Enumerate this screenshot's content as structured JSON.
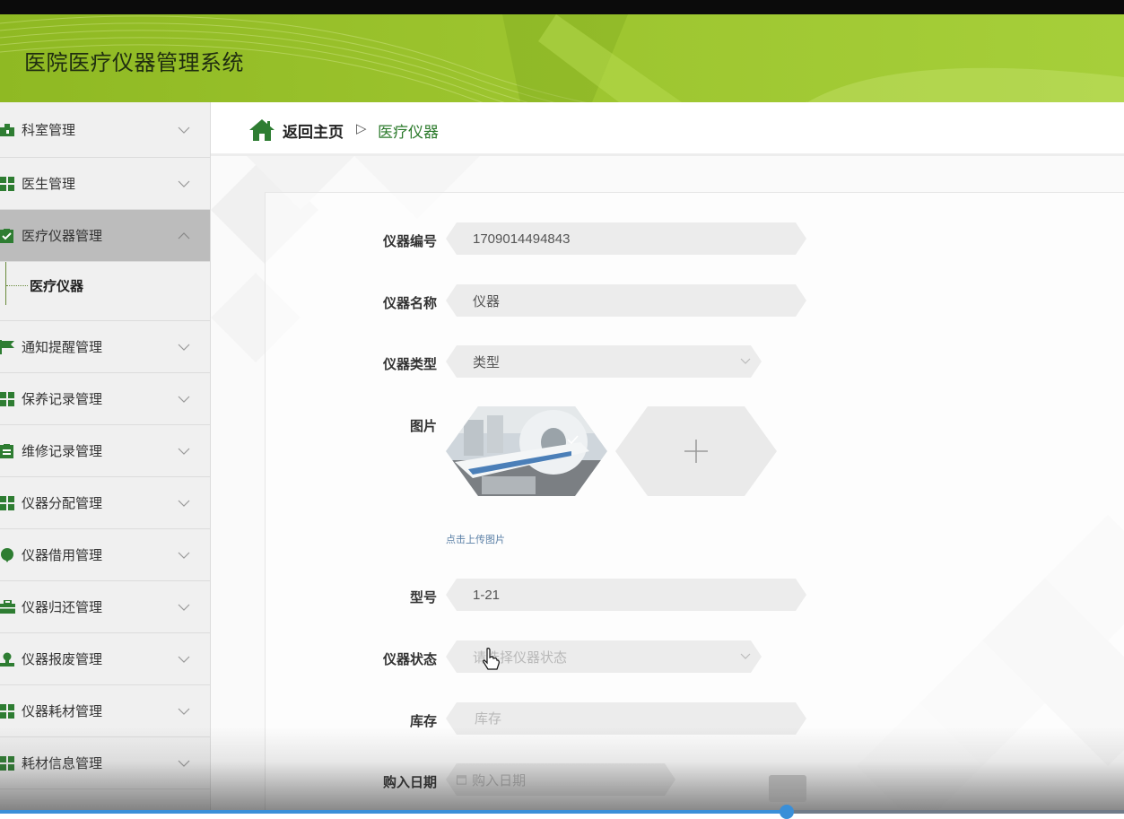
{
  "app": {
    "title": "医院医疗仪器管理系统"
  },
  "colors": {
    "header": "#9cc42e",
    "accent": "#2b7a2b",
    "active_menu": "#bcbcbc",
    "progress": "#3a8fd8"
  },
  "sidebar": {
    "items": [
      {
        "label": "科室管理",
        "icon": "department-icon",
        "expanded": false
      },
      {
        "label": "医生管理",
        "icon": "grid-icon",
        "expanded": false
      },
      {
        "label": "医疗仪器管理",
        "icon": "check-clipboard-icon",
        "expanded": true,
        "active": true
      },
      {
        "label": "通知提醒管理",
        "icon": "flag-icon",
        "expanded": false
      },
      {
        "label": "保养记录管理",
        "icon": "grid-icon",
        "expanded": false
      },
      {
        "label": "维修记录管理",
        "icon": "clipboard-icon",
        "expanded": false
      },
      {
        "label": "仪器分配管理",
        "icon": "grid-icon",
        "expanded": false
      },
      {
        "label": "仪器借用管理",
        "icon": "pin-icon",
        "expanded": false
      },
      {
        "label": "仪器归还管理",
        "icon": "briefcase-icon",
        "expanded": false
      },
      {
        "label": "仪器报废管理",
        "icon": "user-icon",
        "expanded": false
      },
      {
        "label": "仪器耗材管理",
        "icon": "grid-icon",
        "expanded": false
      },
      {
        "label": "耗材信息管理",
        "icon": "grid-icon",
        "expanded": false
      }
    ],
    "submenu": {
      "label": "医疗仪器"
    }
  },
  "breadcrumb": {
    "home": "返回主页",
    "separator": "▷",
    "current": "医疗仪器"
  },
  "form": {
    "code": {
      "label": "仪器编号",
      "value": "1709014494843"
    },
    "name": {
      "label": "仪器名称",
      "value": "仪器"
    },
    "type": {
      "label": "仪器类型",
      "value": "类型"
    },
    "image": {
      "label": "图片",
      "hint": "点击上传图片",
      "add_glyph": "+"
    },
    "model": {
      "label": "型号",
      "value": "1-21"
    },
    "status": {
      "label": "仪器状态",
      "placeholder": "请选择仪器状态"
    },
    "stock": {
      "label": "库存",
      "placeholder": "库存"
    },
    "purchase_date": {
      "label": "购入日期",
      "placeholder": "购入日期"
    }
  },
  "video": {
    "progress": 0.7
  }
}
